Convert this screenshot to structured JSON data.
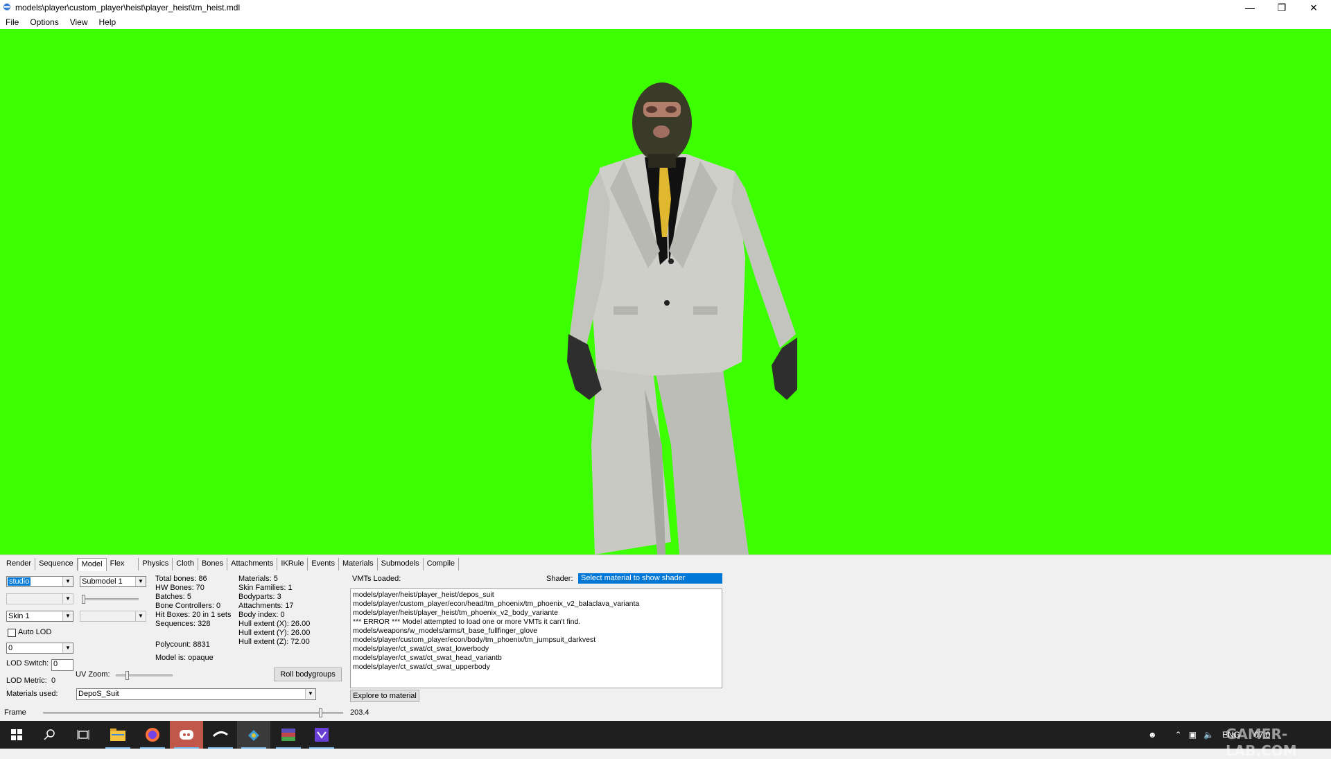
{
  "window": {
    "title": "models\\player\\custom_player\\heist\\player_heist\\tm_heist.mdl",
    "minimize": "—",
    "restore": "❐",
    "close": "✕"
  },
  "menu": [
    "File",
    "Options",
    "View",
    "Help"
  ],
  "viewport": {
    "background": "#3cff00"
  },
  "tabs": [
    "Render",
    "Sequence",
    "Model",
    "Flex",
    "Physics",
    "Cloth",
    "Bones",
    "Attachments",
    "IKRule",
    "Events",
    "Materials",
    "Submodels",
    "Compile"
  ],
  "active_tab": "Model",
  "model_panel": {
    "bodypart_select": "studio",
    "submodel_select": "Submodel 1",
    "skin_select": "Skin 1",
    "auto_lod_label": "Auto LOD",
    "lod_select": "0",
    "lod_switch_label": "LOD Switch:",
    "lod_switch_value": "0",
    "lod_metric_label": "LOD Metric:",
    "lod_metric_value": "0",
    "uv_zoom_label": "UV Zoom:",
    "roll_bodygroups": "Roll bodygroups",
    "materials_used_label": "Materials used:",
    "materials_used_value": "DepoS_Suit",
    "stats_left": [
      "Total bones: 86",
      "HW Bones: 70",
      "Batches: 5",
      "Bone Controllers: 0",
      "Hit Boxes: 20 in 1 sets",
      "Sequences: 328"
    ],
    "polycount": "Polycount: 8831",
    "model_is": "Model is: opaque",
    "stats_right": [
      "Materials: 5",
      "Skin Families: 1",
      "Bodyparts: 3",
      "Attachments: 17",
      "Body index: 0",
      "Hull extent (X): 26.00",
      "Hull extent (Y): 26.00",
      "Hull extent (Z): 72.00"
    ],
    "vmts_label": "VMTs Loaded:",
    "shader_label": "Shader:",
    "shader_value": "Select material to show shader",
    "vmts": [
      "models/player/heist/player_heist/depos_suit",
      "models/player/custom_player/econ/head/tm_phoenix/tm_phoenix_v2_balaclava_varianta",
      "models/player/heist/player_heist/tm_phoenix_v2_body_variante",
      "*** ERROR *** Model attempted to load one or more VMTs it can't find.",
      "models/weapons/w_models/arms/t_base_fullfinger_glove",
      "models/player/custom_player/econ/body/tm_phoenix/tm_jumpsuit_darkvest",
      "models/player/ct_swat/ct_swat_lowerbody",
      "models/player/ct_swat/ct_swat_head_variantb",
      "models/player/ct_swat/ct_swat_upperbody"
    ],
    "explore_button": "Explore to material"
  },
  "frame": {
    "label": "Frame",
    "value": "203.4",
    "position_fraction": 0.92
  },
  "taskbar": {
    "icons": [
      "windows-start-icon",
      "search-icon",
      "task-view-icon",
      "file-explorer-icon",
      "firefox-icon",
      "discord-icon",
      "steam-icon",
      "hlmv-icon",
      "winrar-icon",
      "vs-icon"
    ],
    "tray_lang": "ENG",
    "tray_date": "07.0"
  },
  "watermark": "GAMER-LAB.COM"
}
